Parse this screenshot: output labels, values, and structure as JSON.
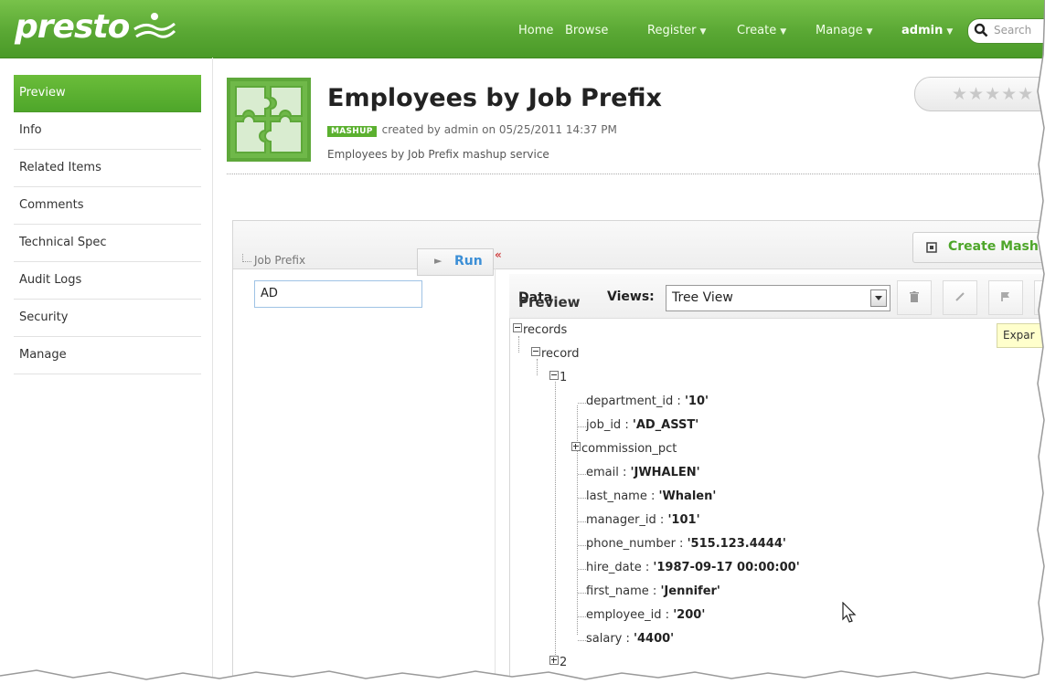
{
  "app": {
    "logo_text": "presto",
    "nav": [
      {
        "label": "Home",
        "dropdown": false
      },
      {
        "label": "Browse",
        "dropdown": false
      },
      {
        "label": "Register",
        "dropdown": true
      },
      {
        "label": "Create",
        "dropdown": true
      },
      {
        "label": "Manage",
        "dropdown": true
      },
      {
        "label": "admin",
        "dropdown": true
      }
    ],
    "search_placeholder": "Search"
  },
  "sidebar": {
    "items": [
      {
        "label": "Preview",
        "active": true
      },
      {
        "label": "Info",
        "active": false
      },
      {
        "label": "Related Items",
        "active": false
      },
      {
        "label": "Comments",
        "active": false
      },
      {
        "label": "Technical Spec",
        "active": false
      },
      {
        "label": "Audit Logs",
        "active": false
      },
      {
        "label": "Security",
        "active": false
      },
      {
        "label": "Manage",
        "active": false
      }
    ]
  },
  "header": {
    "title": "Employees by Job Prefix",
    "badge": "MASHUP",
    "created": "created by admin on 05/25/2011 14:37 PM",
    "description": "Employees by Job Prefix mashup service",
    "rating_stars": "★★★★★"
  },
  "toolbar": {
    "create_label": "Create Mash"
  },
  "params": {
    "label": "Job Prefix",
    "value": "AD",
    "run_label": "Run",
    "collapse_glyph": "«"
  },
  "data_panel": {
    "data_label": "Data",
    "views_label": "Views:",
    "view_value": "Tree View",
    "preview_label": "Preview",
    "tooltip": "Expar"
  },
  "tree": {
    "root": "records",
    "child": "record",
    "item1": "1",
    "item2": "2",
    "fields": [
      {
        "key": "department_id",
        "value": "'10'"
      },
      {
        "key": "job_id",
        "value": "'AD_ASST'"
      },
      {
        "key": "commission_pct",
        "value": ""
      },
      {
        "key": "email",
        "value": "'JWHALEN'"
      },
      {
        "key": "last_name",
        "value": "'Whalen'"
      },
      {
        "key": "manager_id",
        "value": "'101'"
      },
      {
        "key": "phone_number",
        "value": "'515.123.4444'"
      },
      {
        "key": "hire_date",
        "value": "'1987-09-17 00:00:00'"
      },
      {
        "key": "first_name",
        "value": "'Jennifer'"
      },
      {
        "key": "employee_id",
        "value": "'200'"
      },
      {
        "key": "salary",
        "value": "'4400'"
      }
    ]
  },
  "colors": {
    "brand_green": "#5aa834",
    "link_blue": "#3c8fd6"
  }
}
